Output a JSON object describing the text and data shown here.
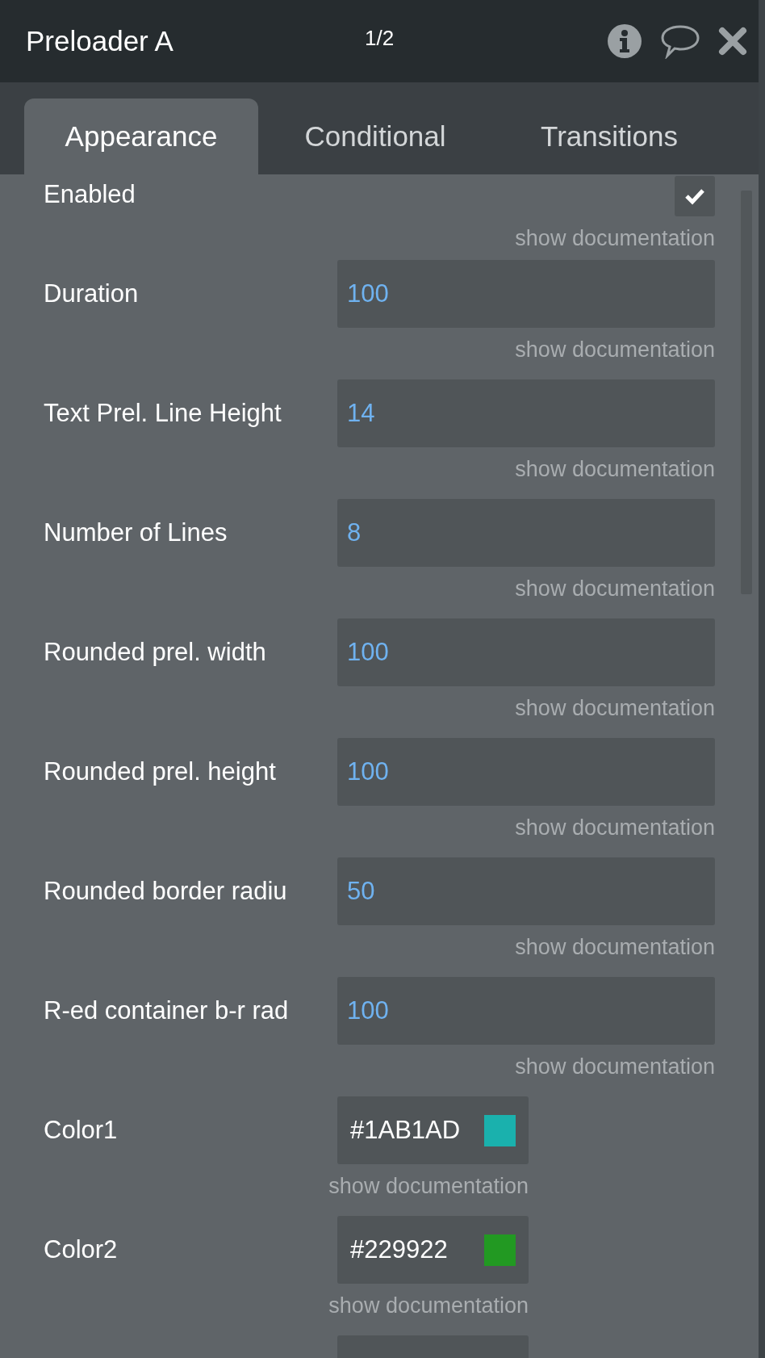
{
  "window": {
    "title": "Preloader A",
    "page_indicator": "1/2"
  },
  "tabs": [
    {
      "label": "Appearance",
      "selected": true
    },
    {
      "label": "Conditional",
      "selected": false
    },
    {
      "label": "Transitions",
      "selected": false
    }
  ],
  "fields": [
    {
      "kind": "checkbox",
      "label": "Enabled",
      "checked": true,
      "doc_link": "show documentation"
    },
    {
      "kind": "number",
      "label": "Duration",
      "value": "100",
      "doc_link": "show documentation"
    },
    {
      "kind": "number",
      "label": "Text Prel. Line Height",
      "value": "14",
      "doc_link": "show documentation"
    },
    {
      "kind": "number",
      "label": "Number of Lines",
      "value": "8",
      "doc_link": "show documentation"
    },
    {
      "kind": "number",
      "label": "Rounded prel. width",
      "value": "100",
      "doc_link": "show documentation"
    },
    {
      "kind": "number",
      "label": "Rounded prel. height",
      "value": "100",
      "doc_link": "show documentation"
    },
    {
      "kind": "number",
      "label": "Rounded border radiu",
      "value": "50",
      "doc_link": "show documentation"
    },
    {
      "kind": "number",
      "label": "R-ed container b-r rad",
      "value": "100",
      "doc_link": "show documentation"
    },
    {
      "kind": "color",
      "label": "Color1",
      "value": "#1AB1AD",
      "color": "#1ab1ad",
      "doc_link": "show documentation"
    },
    {
      "kind": "color",
      "label": "Color2",
      "value": "#229922",
      "color": "#229922",
      "doc_link": "show documentation"
    },
    {
      "kind": "color"
    }
  ]
}
